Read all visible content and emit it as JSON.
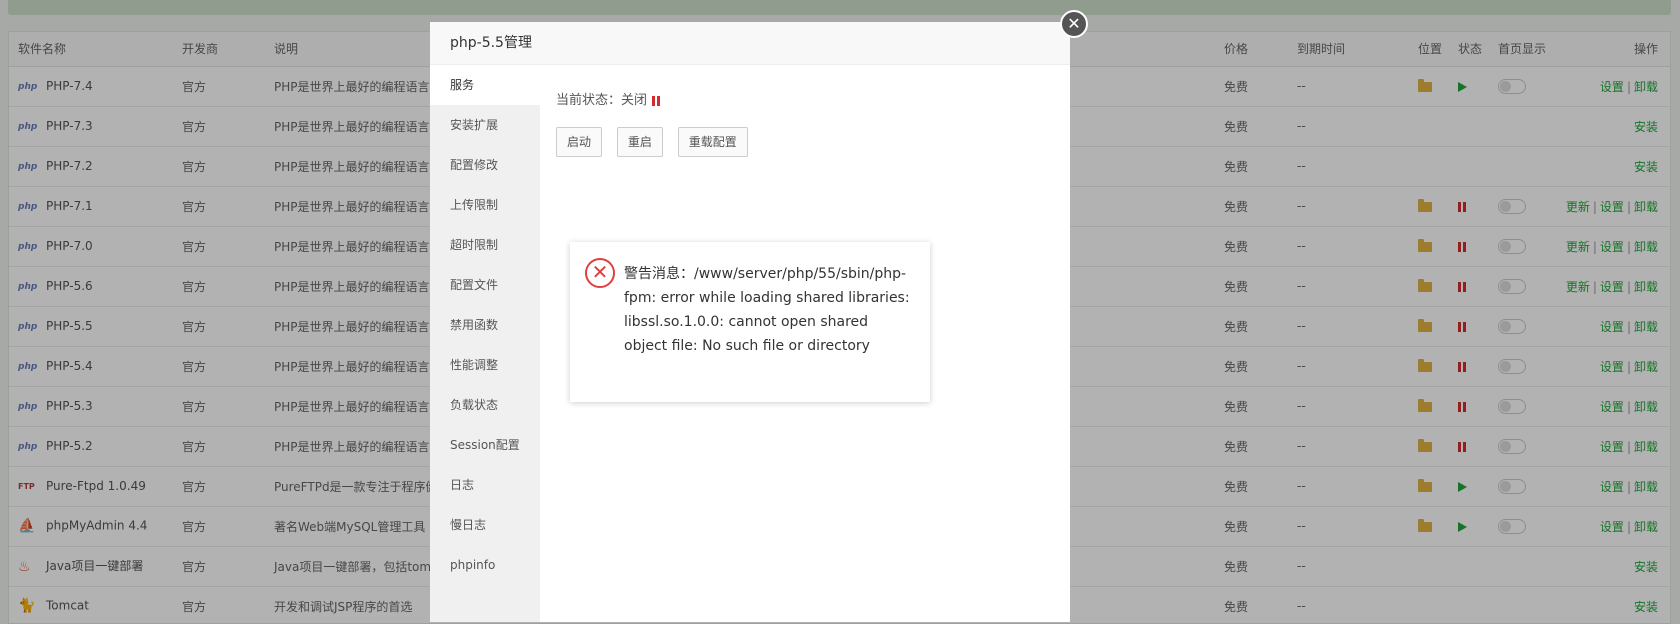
{
  "table": {
    "headers": {
      "name": "软件名称",
      "dev": "开发商",
      "desc": "说明",
      "price": "价格",
      "expire": "到期时间",
      "location": "位置",
      "state": "状态",
      "home": "首页显示",
      "ops": "操作"
    },
    "rows": [
      {
        "icon": "php",
        "name": "PHP-7.4",
        "dev": "官方",
        "desc": "PHP是世界上最好的编程语言",
        "price": "免费",
        "expire": "--",
        "folder": true,
        "state": "running",
        "toggle": true,
        "ops": [
          "设置",
          "卸载"
        ]
      },
      {
        "icon": "php",
        "name": "PHP-7.3",
        "dev": "官方",
        "desc": "PHP是世界上最好的编程语言",
        "price": "免费",
        "expire": "--",
        "folder": false,
        "state": "",
        "toggle": false,
        "ops": [
          "安装"
        ]
      },
      {
        "icon": "php",
        "name": "PHP-7.2",
        "dev": "官方",
        "desc": "PHP是世界上最好的编程语言",
        "price": "免费",
        "expire": "--",
        "folder": false,
        "state": "",
        "toggle": false,
        "ops": [
          "安装"
        ]
      },
      {
        "icon": "php",
        "name": "PHP-7.1",
        "dev": "官方",
        "desc": "PHP是世界上最好的编程语言",
        "price": "免费",
        "expire": "--",
        "folder": true,
        "state": "stopped",
        "toggle": true,
        "ops": [
          "更新",
          "设置",
          "卸载"
        ]
      },
      {
        "icon": "php",
        "name": "PHP-7.0",
        "dev": "官方",
        "desc": "PHP是世界上最好的编程语言",
        "price": "免费",
        "expire": "--",
        "folder": true,
        "state": "stopped",
        "toggle": true,
        "ops": [
          "更新",
          "设置",
          "卸载"
        ]
      },
      {
        "icon": "php",
        "name": "PHP-5.6",
        "dev": "官方",
        "desc": "PHP是世界上最好的编程语言",
        "price": "免费",
        "expire": "--",
        "folder": true,
        "state": "stopped",
        "toggle": true,
        "ops": [
          "更新",
          "设置",
          "卸载"
        ]
      },
      {
        "icon": "php",
        "name": "PHP-5.5",
        "dev": "官方",
        "desc": "PHP是世界上最好的编程语言",
        "price": "免费",
        "expire": "--",
        "folder": true,
        "state": "stopped",
        "toggle": true,
        "ops": [
          "设置",
          "卸载"
        ]
      },
      {
        "icon": "php",
        "name": "PHP-5.4",
        "dev": "官方",
        "desc": "PHP是世界上最好的编程语言",
        "price": "免费",
        "expire": "--",
        "folder": true,
        "state": "stopped",
        "toggle": true,
        "ops": [
          "设置",
          "卸载"
        ]
      },
      {
        "icon": "php",
        "name": "PHP-5.3",
        "dev": "官方",
        "desc": "PHP是世界上最好的编程语言",
        "price": "免费",
        "expire": "--",
        "folder": true,
        "state": "stopped",
        "toggle": true,
        "ops": [
          "设置",
          "卸载"
        ]
      },
      {
        "icon": "php",
        "name": "PHP-5.2",
        "dev": "官方",
        "desc": "PHP是世界上最好的编程语言",
        "price": "免费",
        "expire": "--",
        "folder": true,
        "state": "stopped",
        "toggle": true,
        "ops": [
          "设置",
          "卸载"
        ]
      },
      {
        "icon": "ftp",
        "name": "Pure-Ftpd 1.0.49",
        "dev": "官方",
        "desc": "PureFTPd是一款专注于程序健",
        "price": "免费",
        "expire": "--",
        "folder": true,
        "state": "running",
        "toggle": true,
        "ops": [
          "设置",
          "卸载"
        ]
      },
      {
        "icon": "pma",
        "name": "phpMyAdmin 4.4",
        "dev": "官方",
        "desc": "著名Web端MySQL管理工具",
        "price": "免费",
        "expire": "--",
        "folder": true,
        "state": "running",
        "toggle": true,
        "ops": [
          "设置",
          "卸载"
        ]
      },
      {
        "icon": "java",
        "name": "Java项目一键部署",
        "dev": "官方",
        "desc": "Java项目一键部署，包括tomc",
        "price": "免费",
        "expire": "--",
        "folder": false,
        "state": "",
        "toggle": false,
        "ops": [
          "安装"
        ]
      },
      {
        "icon": "tomcat",
        "name": "Tomcat",
        "dev": "官方",
        "desc": "开发和调试JSP程序的首选",
        "price": "免费",
        "expire": "--",
        "folder": false,
        "state": "",
        "toggle": false,
        "ops": [
          "安装"
        ]
      }
    ]
  },
  "icon_labels": {
    "php": "php",
    "ftp": "FTP",
    "pma": "⛵",
    "java": "♨",
    "tomcat": "🐈"
  },
  "dialog": {
    "title": "php-5.5管理",
    "close": "✕",
    "menu": [
      "服务",
      "安装扩展",
      "配置修改",
      "上传限制",
      "超时限制",
      "配置文件",
      "禁用函数",
      "性能调整",
      "负载状态",
      "Session配置",
      "日志",
      "慢日志",
      "phpinfo"
    ],
    "status_label": "当前状态：关闭",
    "buttons": {
      "start": "启动",
      "restart": "重启",
      "reload": "重载配置"
    }
  },
  "alert": {
    "icon": "✕",
    "message": "警告消息：/www/server/php/55/sbin/php-fpm: error while loading shared libraries: libssl.so.1.0.0: cannot open shared object file: No such file or directory"
  },
  "colors": {
    "accent": "#20a53a",
    "stop": "#d42c2c",
    "folder": "#e1b441"
  }
}
